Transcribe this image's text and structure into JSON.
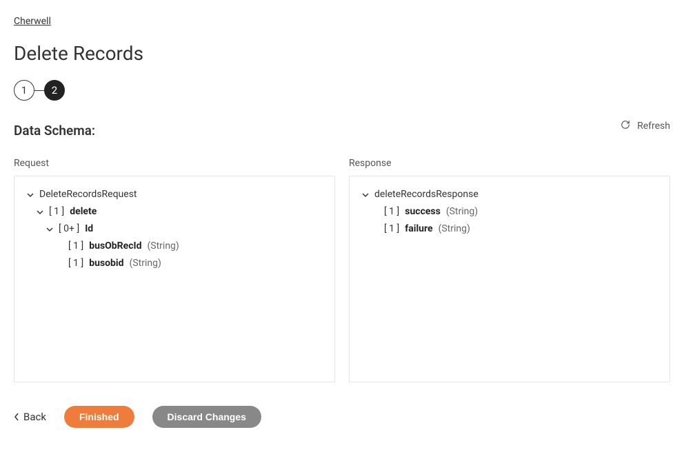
{
  "breadcrumb": "Cherwell",
  "page_title": "Delete Records",
  "stepper": {
    "step1": "1",
    "step2": "2"
  },
  "section_title": "Data Schema:",
  "refresh_label": "Refresh",
  "request_label": "Request",
  "response_label": "Response",
  "request_tree": {
    "root": "DeleteRecordsRequest",
    "delete_bracket": "[ 1 ]",
    "delete_name": "delete",
    "id_bracket": "[ 0+ ]",
    "id_name": "Id",
    "busObRecId_bracket": "[ 1 ]",
    "busObRecId_name": "busObRecId",
    "busObRecId_type": "(String)",
    "busobid_bracket": "[ 1 ]",
    "busobid_name": "busobid",
    "busobid_type": "(String)"
  },
  "response_tree": {
    "root": "deleteRecordsResponse",
    "success_bracket": "[ 1 ]",
    "success_name": "success",
    "success_type": "(String)",
    "failure_bracket": "[ 1 ]",
    "failure_name": "failure",
    "failure_type": "(String)"
  },
  "footer": {
    "back": "Back",
    "finished": "Finished",
    "discard": "Discard Changes"
  }
}
